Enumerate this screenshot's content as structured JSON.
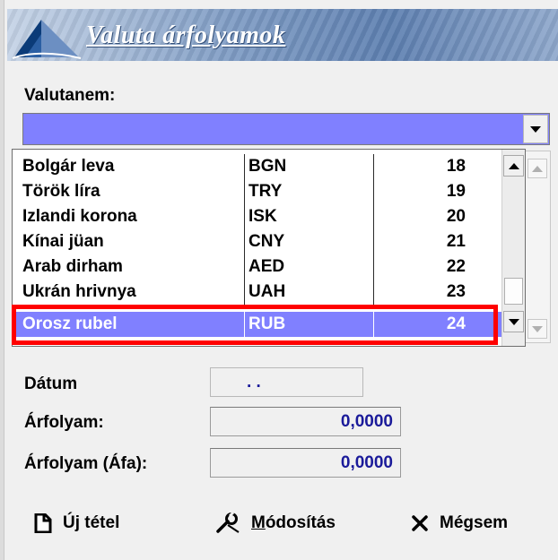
{
  "window": {
    "title": "Valuta árfolyamok"
  },
  "currency": {
    "label": "Valutanem:",
    "selected_value": "",
    "list": [
      {
        "name": "Bolgár leva",
        "code": "BGN",
        "num": "18",
        "selected": false
      },
      {
        "name": "Török líra",
        "code": "TRY",
        "num": "19",
        "selected": false
      },
      {
        "name": "Izlandi korona",
        "code": "ISK",
        "num": "20",
        "selected": false
      },
      {
        "name": "Kínai jüan",
        "code": "CNY",
        "num": "21",
        "selected": false
      },
      {
        "name": "Arab dirham",
        "code": "AED",
        "num": "22",
        "selected": false
      },
      {
        "name": "Ukrán hrivnya",
        "code": "UAH",
        "num": "23",
        "selected": false
      },
      {
        "name": "Orosz rubel",
        "code": "RUB",
        "num": "24",
        "selected": true
      }
    ]
  },
  "fields": {
    "date": {
      "label": "Dátum",
      "value": ". ."
    },
    "rate": {
      "label": "Árfolyam:",
      "value": "0,0000"
    },
    "rate_vat": {
      "label": "Árfolyam (Áfa):",
      "value": "0,0000"
    }
  },
  "buttons": {
    "new": {
      "label": "Új tétel",
      "icon": "document-icon"
    },
    "modify": {
      "label": "Módosítás",
      "icon": "wrench-icon"
    },
    "cancel": {
      "label": "Mégsem",
      "icon": "x-icon"
    }
  },
  "colors": {
    "selection": "#8080ff",
    "highlight": "#ff0000",
    "value_text": "#1a1a9a"
  }
}
